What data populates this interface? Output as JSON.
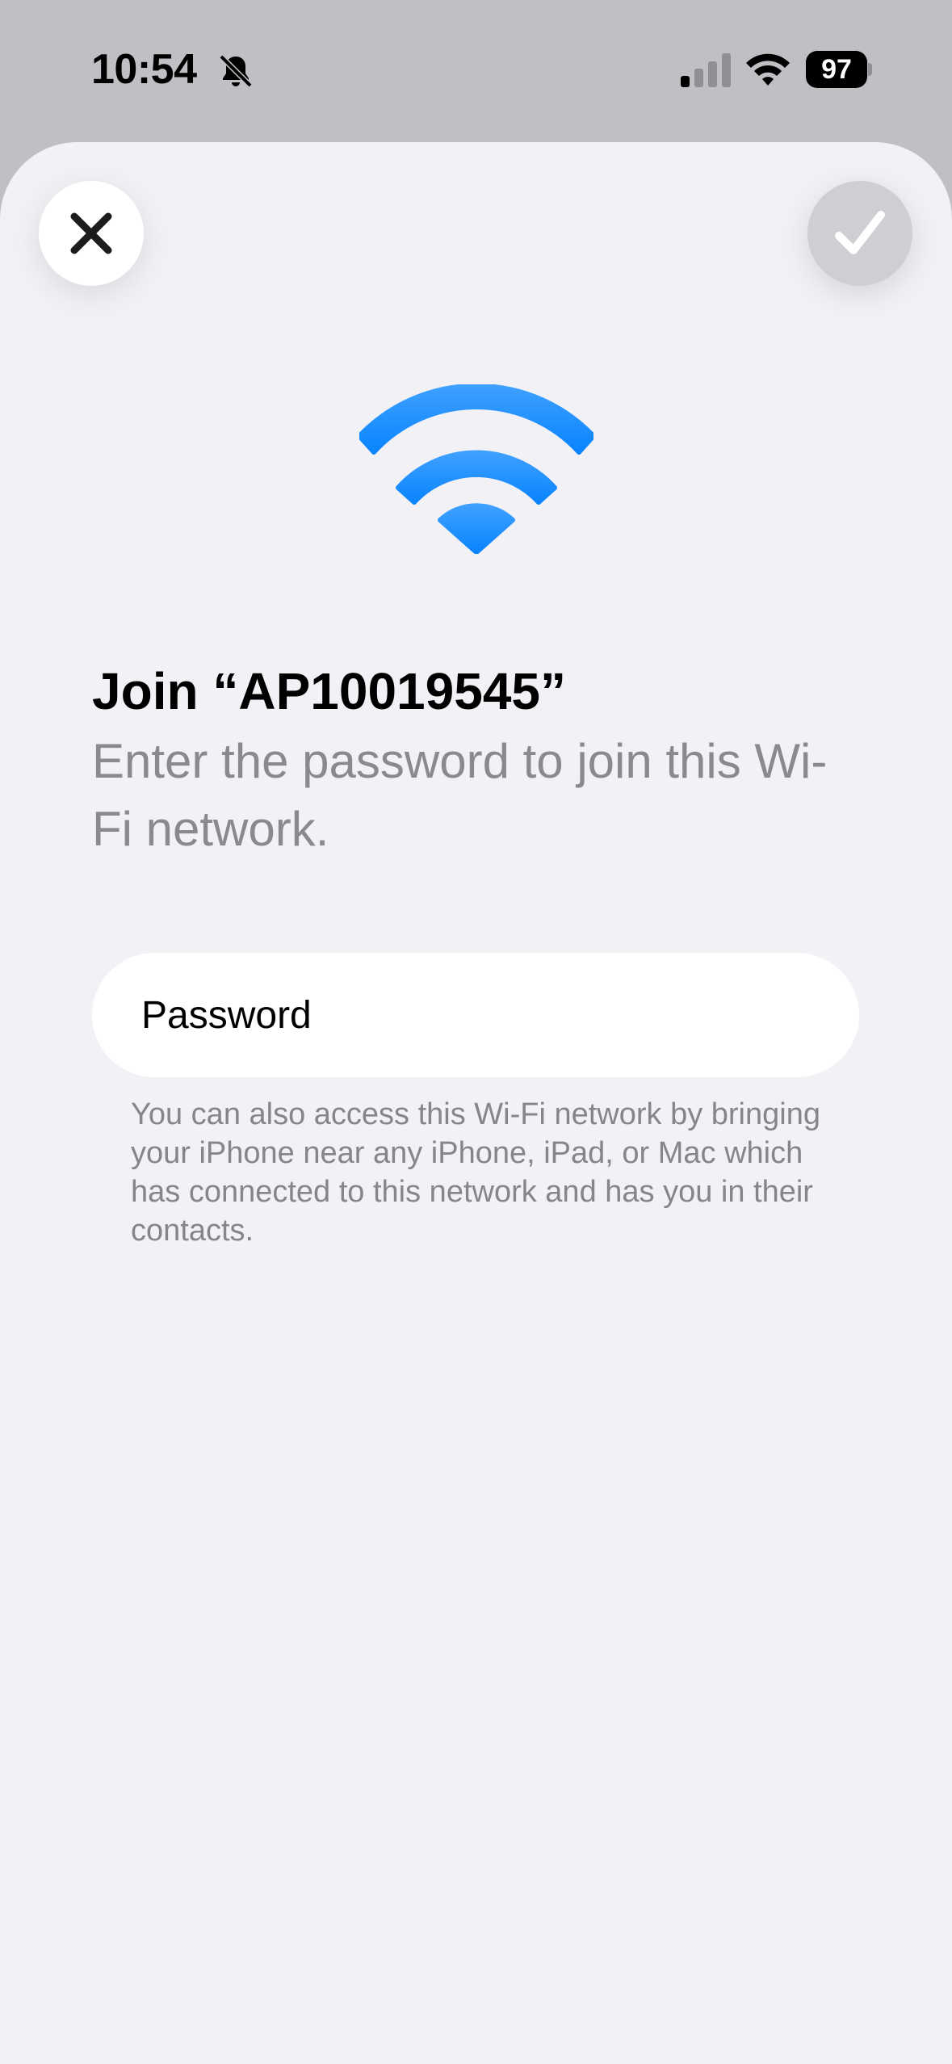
{
  "status_bar": {
    "time": "10:54",
    "battery_level": "97",
    "icons": [
      "bell-slash-icon",
      "cellular-signal-icon",
      "wifi-icon",
      "battery-icon"
    ]
  },
  "sheet": {
    "close_icon": "xmark-icon",
    "confirm_icon": "checkmark-icon",
    "hero_icon": "wifi-icon",
    "title": "Join “AP10019545”",
    "subtitle": "Enter the password to join this Wi-Fi network.",
    "password": {
      "placeholder": "Password",
      "value": ""
    },
    "helper_text": "You can also access this Wi-Fi network by bringing your iPhone near any iPhone, iPad, or Mac which has connected to this network and has you in their contacts."
  },
  "colors": {
    "accent": "#0a84ff",
    "sheet_background": "#f2f1f6",
    "secondary_text": "#8a8a8e",
    "disabled_button": "#cfcfd3"
  }
}
